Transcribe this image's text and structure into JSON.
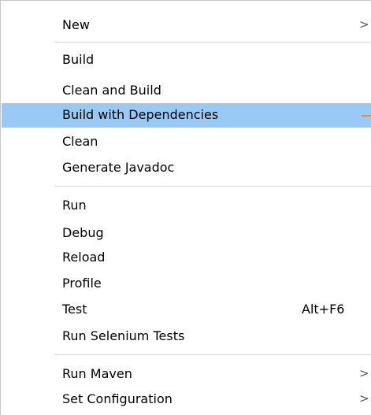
{
  "menu": {
    "new": "New",
    "build": "Build",
    "clean_and_build": "Clean and Build",
    "build_with_dependencies": "Build with Dependencies",
    "clean": "Clean",
    "generate_javadoc": "Generate Javadoc",
    "run": "Run",
    "debug": "Debug",
    "reload": "Reload",
    "profile": "Profile",
    "test": "Test",
    "test_shortcut": "Alt+F6",
    "run_selenium_tests": "Run Selenium Tests",
    "run_maven": "Run Maven",
    "set_configuration": "Set Configuration",
    "submenu_arrow": ">"
  },
  "colors": {
    "highlight": "#99c9f5",
    "separator": "#d7d7d7",
    "cursor_mark": "#ff8a00"
  },
  "icons": {
    "submenu": "chevron-right-icon"
  }
}
